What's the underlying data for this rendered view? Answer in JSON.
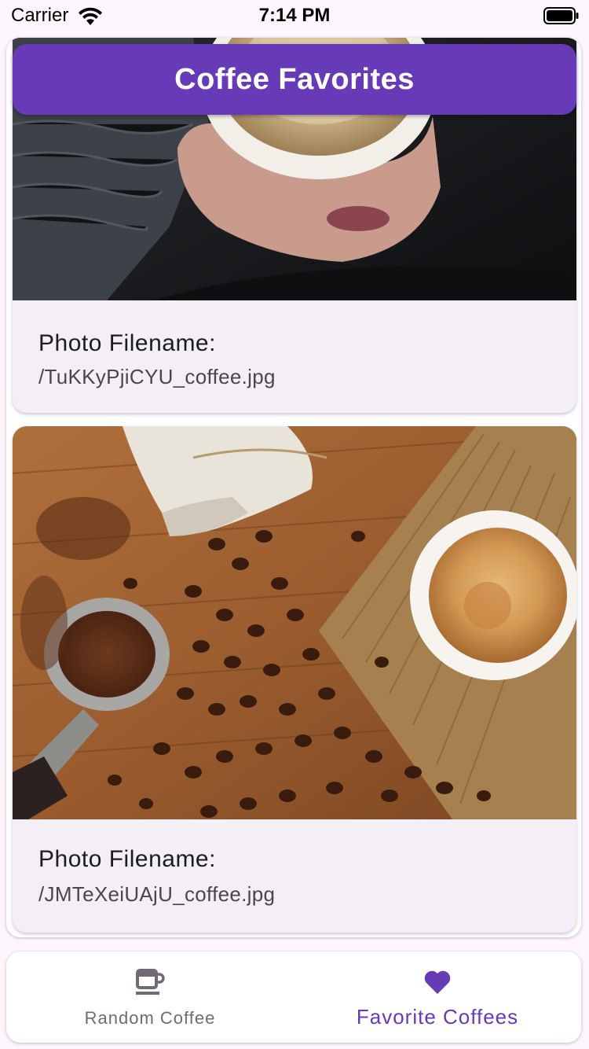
{
  "status_bar": {
    "carrier": "Carrier",
    "time": "7:14 PM"
  },
  "app_bar": {
    "title": "Coffee Favorites",
    "color": "#673ab7"
  },
  "favorites": [
    {
      "label": "Photo Filename:",
      "filename": "/TuKKyPjiCYU_coffee.jpg",
      "photo": "hand-holding-cup-of-coffee"
    },
    {
      "label": "Photo Filename:",
      "filename": "/JMTeXeiUAjU_coffee.jpg",
      "photo": "espresso-cup-with-coffee-beans"
    }
  ],
  "bottom_nav": {
    "items": [
      {
        "label": "Random Coffee",
        "icon": "coffee-cup-icon",
        "selected": false
      },
      {
        "label": "Favorite Coffees",
        "icon": "heart-icon",
        "selected": true
      }
    ]
  },
  "colors": {
    "accent": "#673ab7",
    "card_background": "#f4eff6",
    "inactive_nav": "#6f6a74"
  }
}
